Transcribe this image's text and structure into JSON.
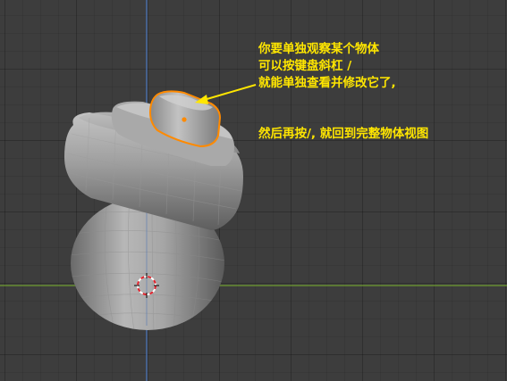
{
  "viewport": {
    "background_color": "#3d3d3d",
    "grid_line_color": "#343434",
    "x_axis_color": "#6e9b2f",
    "z_axis_color": "#4c73b5",
    "selection_outline_color": "#ff8a00",
    "annotation_text_color": "#ffe600"
  },
  "annotation": {
    "lines": [
      "你要单独观察某个物体",
      "可以按键盘斜杠 /",
      "就能单独查看并修改它了,"
    ],
    "followup": "然后再按/, 就回到完整物体视图"
  },
  "scene_objects": {
    "body": "egg-shaped mesh",
    "ring": "torus mesh",
    "collar": "small torus mesh",
    "cap": "selected cylinder mesh",
    "cursor": "3d-cursor"
  }
}
